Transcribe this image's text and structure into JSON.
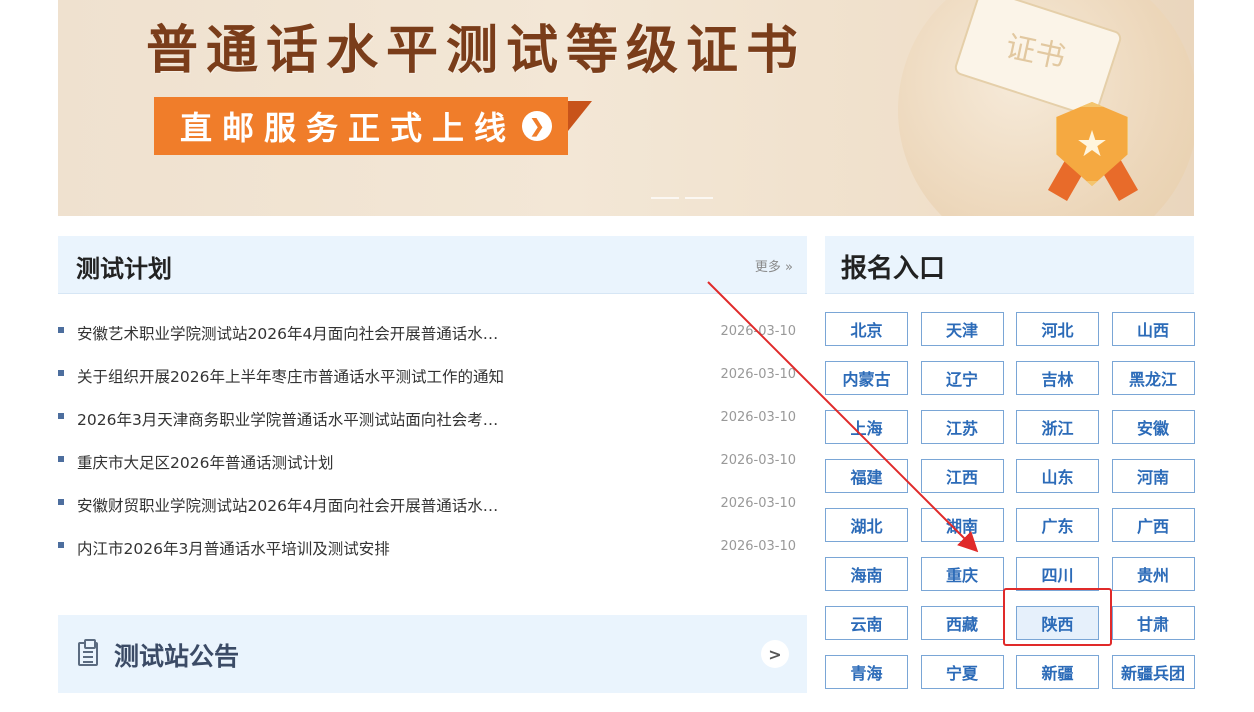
{
  "banner": {
    "title": "普通话水平测试等级证书",
    "button_label": "直邮服务正式上线",
    "scroll_text": "证书",
    "accent": "#f07d2a",
    "title_color": "#7a3d1a"
  },
  "test_plan": {
    "title": "测试计划",
    "more_label": "更多 »",
    "items": [
      {
        "title": "安徽艺术职业学院测试站2026年4月面向社会开展普通话水…",
        "date": "2026-03-10"
      },
      {
        "title": "关于组织开展2026年上半年枣庄市普通话水平测试工作的通知",
        "date": "2026-03-10"
      },
      {
        "title": "2026年3月天津商务职业学院普通话水平测试站面向社会考…",
        "date": "2026-03-10"
      },
      {
        "title": "重庆市大足区2026年普通话测试计划",
        "date": "2026-03-10"
      },
      {
        "title": "安徽财贸职业学院测试站2026年4月面向社会开展普通话水…",
        "date": "2026-03-10"
      },
      {
        "title": "内江市2026年3月普通话水平培训及测试安排",
        "date": "2026-03-10"
      }
    ]
  },
  "notice": {
    "title": "测试站公告",
    "icon": "clipboard-icon",
    "arrow_icon": "chevron-right-icon"
  },
  "registration": {
    "title": "报名入口",
    "provinces": [
      "北京",
      "天津",
      "河北",
      "山西",
      "内蒙古",
      "辽宁",
      "吉林",
      "黑龙江",
      "上海",
      "江苏",
      "浙江",
      "安徽",
      "福建",
      "江西",
      "山东",
      "河南",
      "湖北",
      "湖南",
      "广东",
      "广西",
      "海南",
      "重庆",
      "四川",
      "贵州",
      "云南",
      "西藏",
      "陕西",
      "甘肃",
      "青海",
      "宁夏",
      "新疆",
      "新疆兵团"
    ],
    "highlighted": "陕西",
    "link_color": "#2c6bb8",
    "highlight_color": "#e02a2a"
  }
}
